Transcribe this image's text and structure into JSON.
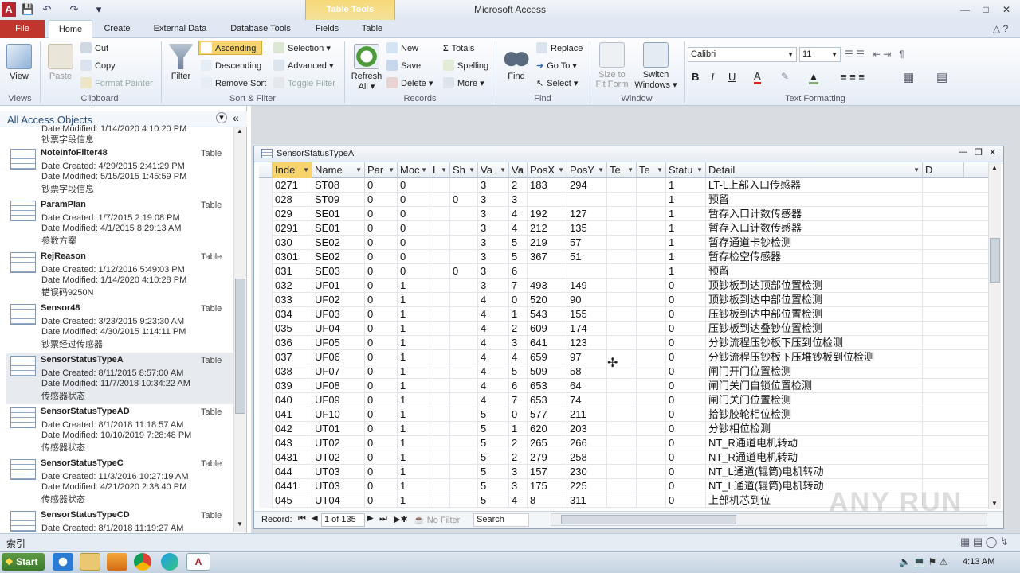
{
  "window": {
    "title": "Microsoft Access",
    "context_tab": "Table Tools"
  },
  "tabs": [
    "File",
    "Home",
    "Create",
    "External Data",
    "Database Tools",
    "Fields",
    "Table"
  ],
  "ribbon": {
    "views": {
      "view": "View",
      "group": "Views"
    },
    "clipboard": {
      "paste": "Paste",
      "cut": "Cut",
      "copy": "Copy",
      "format_painter": "Format Painter",
      "group": "Clipboard"
    },
    "sort": {
      "filter": "Filter",
      "ascending": "Ascending",
      "descending": "Descending",
      "remove_sort": "Remove Sort",
      "selection": "Selection",
      "advanced": "Advanced",
      "toggle_filter": "Toggle Filter",
      "group": "Sort & Filter"
    },
    "records": {
      "refresh": "Refresh",
      "refresh2": "All",
      "new": "New",
      "save": "Save",
      "delete": "Delete",
      "totals": "Totals",
      "spelling": "Spelling",
      "more": "More",
      "group": "Records"
    },
    "find": {
      "find": "Find",
      "replace": "Replace",
      "goto": "Go To",
      "select": "Select",
      "group": "Find"
    },
    "window": {
      "size": "Size to",
      "size2": "Fit Form",
      "switch": "Switch",
      "switch2": "Windows",
      "group": "Window"
    },
    "text": {
      "font": "Calibri",
      "size": "11",
      "group": "Text Formatting"
    }
  },
  "nav": {
    "header": "All Access Objects",
    "partial_top": {
      "line1": "Date Modified: 1/14/2020 4:10:20 PM",
      "line2": "钞票字段信息"
    },
    "items": [
      {
        "name": "NoteInfoFilter48",
        "type": "Table",
        "created": "Date Created: 4/29/2015 2:41:29 PM",
        "modified": "Date Modified: 5/15/2015 1:45:59 PM",
        "desc": "钞票字段信息"
      },
      {
        "name": "ParamPlan",
        "type": "Table",
        "created": "Date Created: 1/7/2015 2:19:08 PM",
        "modified": "Date Modified: 4/1/2015 8:29:13 AM",
        "desc": "参数方案"
      },
      {
        "name": "RejReason",
        "type": "Table",
        "created": "Date Created: 1/12/2016 5:49:03 PM",
        "modified": "Date Modified: 1/14/2020 4:10:28 PM",
        "desc": "错误码9250N"
      },
      {
        "name": "Sensor48",
        "type": "Table",
        "created": "Date Created: 3/23/2015 9:23:30 AM",
        "modified": "Date Modified: 4/30/2015 1:14:11 PM",
        "desc": "钞票经过传感器"
      },
      {
        "name": "SensorStatusTypeA",
        "type": "Table",
        "created": "Date Created: 8/11/2015 8:57:00 AM",
        "modified": "Date Modified: 11/7/2018 10:34:22 AM",
        "desc": "传感器状态"
      },
      {
        "name": "SensorStatusTypeAD",
        "type": "Table",
        "created": "Date Created: 8/1/2018 11:18:57 AM",
        "modified": "Date Modified: 10/10/2019 7:28:48 PM",
        "desc": "传感器状态"
      },
      {
        "name": "SensorStatusTypeC",
        "type": "Table",
        "created": "Date Created: 11/3/2016 10:27:19 AM",
        "modified": "Date Modified: 4/21/2020 2:38:40 PM",
        "desc": "传感器状态"
      },
      {
        "name": "SensorStatusTypeCD",
        "type": "Table",
        "created": "Date Created: 8/1/2018 11:19:27 AM",
        "modified": "",
        "desc": ""
      }
    ]
  },
  "table": {
    "title": "SensorStatusTypeA",
    "columns": [
      "Inde",
      "Name",
      "Par",
      "Moc",
      "L",
      "Sh",
      "Va",
      "Va",
      "PosX",
      "PosY",
      "Te",
      "Te",
      "Statu",
      "Detail",
      "D"
    ],
    "rows": [
      [
        "0271",
        "ST08",
        "0",
        "0",
        "",
        "",
        "3",
        "2",
        "183",
        "294",
        "",
        "",
        "1",
        "LT-L上部入口传感器"
      ],
      [
        "028",
        "ST09",
        "0",
        "0",
        "",
        "0",
        "3",
        "3",
        "",
        "",
        "",
        "",
        "1",
        "预留"
      ],
      [
        "029",
        "SE01",
        "0",
        "0",
        "",
        "",
        "3",
        "4",
        "192",
        "127",
        "",
        "",
        "1",
        "暂存入口计数传感器"
      ],
      [
        "0291",
        "SE01",
        "0",
        "0",
        "",
        "",
        "3",
        "4",
        "212",
        "135",
        "",
        "",
        "1",
        "暂存入口计数传感器"
      ],
      [
        "030",
        "SE02",
        "0",
        "0",
        "",
        "",
        "3",
        "5",
        "219",
        "57",
        "",
        "",
        "1",
        "暂存通道卡钞检测"
      ],
      [
        "0301",
        "SE02",
        "0",
        "0",
        "",
        "",
        "3",
        "5",
        "367",
        "51",
        "",
        "",
        "1",
        "暂存检空传感器"
      ],
      [
        "031",
        "SE03",
        "0",
        "0",
        "",
        "0",
        "3",
        "6",
        "",
        "",
        "",
        "",
        "1",
        "预留"
      ],
      [
        "032",
        "UF01",
        "0",
        "1",
        "",
        "",
        "3",
        "7",
        "493",
        "149",
        "",
        "",
        "0",
        "顶钞板到达顶部位置检测"
      ],
      [
        "033",
        "UF02",
        "0",
        "1",
        "",
        "",
        "4",
        "0",
        "520",
        "90",
        "",
        "",
        "0",
        "顶钞板到达中部位置检测"
      ],
      [
        "034",
        "UF03",
        "0",
        "1",
        "",
        "",
        "4",
        "1",
        "543",
        "155",
        "",
        "",
        "0",
        "压钞板到达中部位置检测"
      ],
      [
        "035",
        "UF04",
        "0",
        "1",
        "",
        "",
        "4",
        "2",
        "609",
        "174",
        "",
        "",
        "0",
        "压钞板到达叠钞位置检测"
      ],
      [
        "036",
        "UF05",
        "0",
        "1",
        "",
        "",
        "4",
        "3",
        "641",
        "123",
        "",
        "",
        "0",
        "分钞流程压钞板下压到位检测"
      ],
      [
        "037",
        "UF06",
        "0",
        "1",
        "",
        "",
        "4",
        "4",
        "659",
        "97",
        "",
        "",
        "0",
        "分钞流程压钞板下压堆钞板到位检测"
      ],
      [
        "038",
        "UF07",
        "0",
        "1",
        "",
        "",
        "4",
        "5",
        "509",
        "58",
        "",
        "",
        "0",
        "闸门开门位置检测"
      ],
      [
        "039",
        "UF08",
        "0",
        "1",
        "",
        "",
        "4",
        "6",
        "653",
        "64",
        "",
        "",
        "0",
        "闸门关门自锁位置检测"
      ],
      [
        "040",
        "UF09",
        "0",
        "1",
        "",
        "",
        "4",
        "7",
        "653",
        "74",
        "",
        "",
        "0",
        "闸门关门位置检测"
      ],
      [
        "041",
        "UF10",
        "0",
        "1",
        "",
        "",
        "5",
        "0",
        "577",
        "211",
        "",
        "",
        "0",
        "拾钞胶轮相位检测"
      ],
      [
        "042",
        "UT01",
        "0",
        "1",
        "",
        "",
        "5",
        "1",
        "620",
        "203",
        "",
        "",
        "0",
        "分钞相位检测"
      ],
      [
        "043",
        "UT02",
        "0",
        "1",
        "",
        "",
        "5",
        "2",
        "265",
        "266",
        "",
        "",
        "0",
        "NT_R通道电机转动"
      ],
      [
        "0431",
        "UT02",
        "0",
        "1",
        "",
        "",
        "5",
        "2",
        "279",
        "258",
        "",
        "",
        "0",
        "NT_R通道电机转动"
      ],
      [
        "044",
        "UT03",
        "0",
        "1",
        "",
        "",
        "5",
        "3",
        "157",
        "230",
        "",
        "",
        "0",
        "NT_L通道(辊筒)电机转动"
      ],
      [
        "0441",
        "UT03",
        "0",
        "1",
        "",
        "",
        "5",
        "3",
        "175",
        "225",
        "",
        "",
        "0",
        "NT_L通道(辊筒)电机转动"
      ],
      [
        "045",
        "UT04",
        "0",
        "1",
        "",
        "",
        "5",
        "4",
        "8",
        "311",
        "",
        "",
        "0",
        "上部机芯到位"
      ]
    ],
    "record_nav": {
      "label": "Record:",
      "position": "1 of 135",
      "filter": "No Filter",
      "search": "Search"
    }
  },
  "status": {
    "left": "索引"
  },
  "taskbar": {
    "start": "Start",
    "time": "4:13 AM"
  },
  "watermark": "ANY RUN"
}
